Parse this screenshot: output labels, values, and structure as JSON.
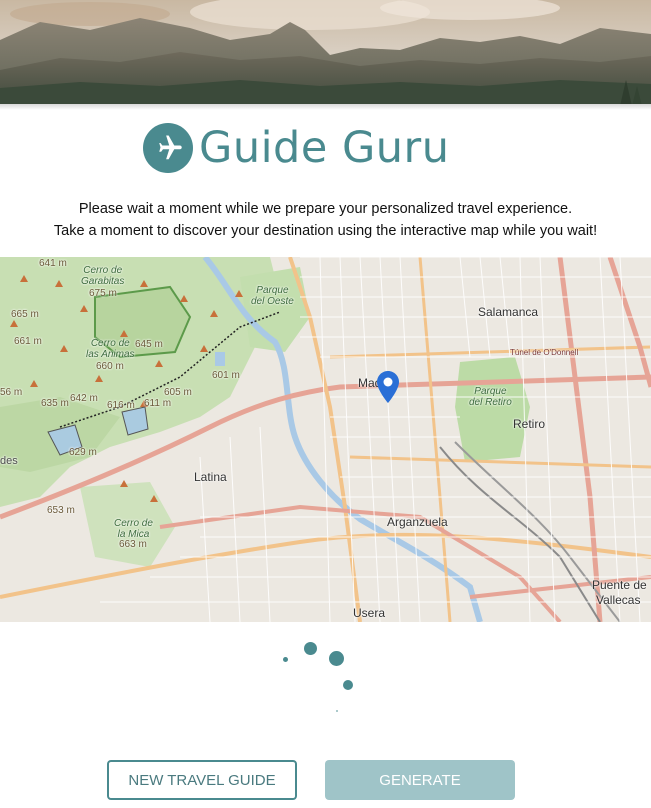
{
  "app": {
    "title": "Guide Guru",
    "logo_icon": "airplane-icon",
    "brand_color": "#4a8a8f"
  },
  "intro": {
    "line1": "Please wait a moment while we prepare your personalized travel experience.",
    "line2": "Take a moment to discover your destination using the interactive map while you wait!"
  },
  "map": {
    "marker_icon": "map-pin-icon",
    "marker_color": "#2a6fd6",
    "places": {
      "madrid": "Madrid",
      "salamanca": "Salamanca",
      "retiro": "Retiro",
      "latina": "Latina",
      "arganzuela": "Arganzuela",
      "usera": "Usera",
      "puente_de_vallecas_1": "Puente de",
      "puente_de_vallecas_2": "Vallecas",
      "cerro_garabitas": "Cerro de\nGarabitas",
      "cerro_animas": "Cerro de\nlas Animas",
      "cerro_mica": "Cerro de\nla Mica",
      "parque_oeste": "Parque\ndel Oeste",
      "parque_retiro": "Parque\ndel Retiro",
      "tunel_odonnell": "Túnel de O'Donnell",
      "des": "des"
    },
    "elevations": {
      "e641": "641 m",
      "e675": "675 m",
      "e665": "665 m",
      "e661": "661 m",
      "e645": "645 m",
      "e660": "660 m",
      "e601": "601 m",
      "e642": "642 m",
      "e635": "635 m",
      "e616": "616 m",
      "e611": "611 m",
      "e605": "605 m",
      "e629": "629 m",
      "e653": "653 m",
      "e663": "663 m",
      "e56": "56 m"
    }
  },
  "actions": {
    "new_guide_label": "NEW TRAVEL GUIDE",
    "generate_label": "GENERATE"
  },
  "status": {
    "loading": true
  }
}
